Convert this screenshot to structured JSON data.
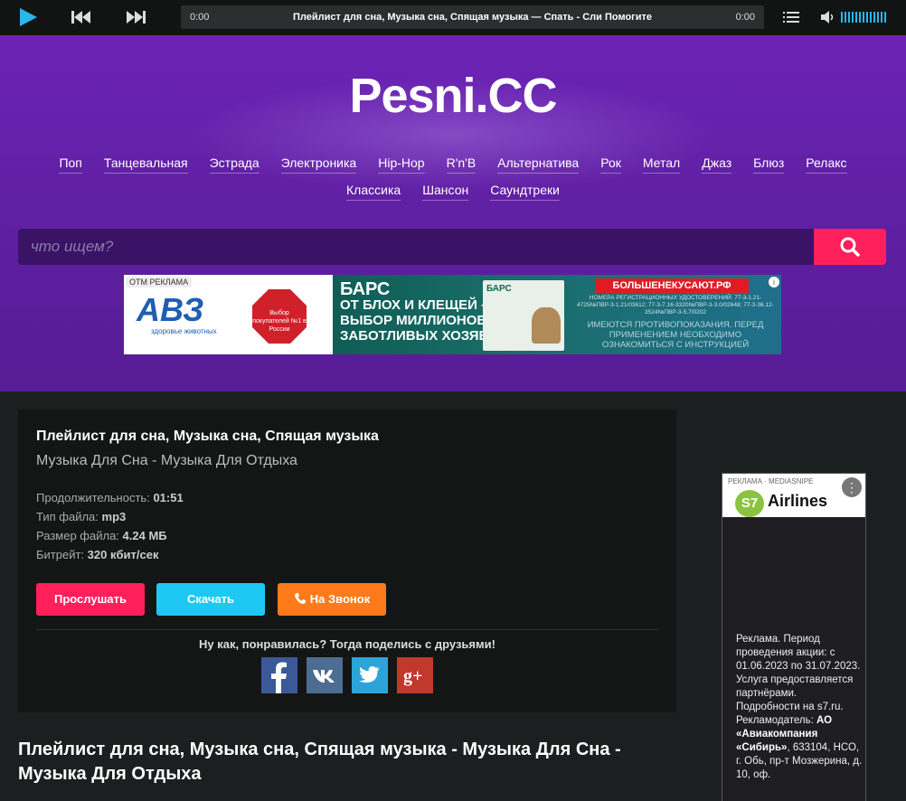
{
  "player": {
    "time_current": "0:00",
    "time_total": "0:00",
    "track_title": "Плейлист для сна, Музыка сна, Спящая музыка — Спать - Сли Помогите"
  },
  "header": {
    "logo": "Pesni.CC",
    "nav_row1": [
      "Поп",
      "Танцевальная",
      "Эстрада",
      "Электроника",
      "Hip-Hop",
      "R'n'B",
      "Альтернатива",
      "Рок",
      "Метал",
      "Джаз",
      "Блюз",
      "Релакс"
    ],
    "nav_row2": [
      "Классика",
      "Шансон",
      "Саундтреки"
    ],
    "search_placeholder": "что ищем?"
  },
  "banner_ad": {
    "label": "ОТМ РЕКЛАМА",
    "brand": "АВЗ",
    "brand_sub": "здоровье животных",
    "badge": "Выбор покупателей №1 в России",
    "headline_big": "БАРС",
    "headline": [
      "ОТ БЛОХ И КЛЕЩЕЙ –",
      "ВЫБОР МИЛЛИОНОВ",
      "ЗАБОТЛИВЫХ ХОЗЯЕВ"
    ],
    "pack_label": "БАРС",
    "site": "БОЛЬШЕНЕКУСАЮТ.РФ",
    "regs": "НОМЕРА РЕГИСТРАЦИОННЫХ УДОСТОВЕРЕНИЙ: 77-3-1.21-4725№ПВР-3-1.21/03612; 77-3-7.16-3320№ПВР-3-3.0/02648; 77-3-36.12-3524№ПВР-3-5.7/0202",
    "warning": "ИМЕЮТСЯ ПРОТИВОПОКАЗАНИЯ. ПЕРЕД ПРИМЕНЕНИЕМ НЕОБХОДИМО ОЗНАКОМИТЬСЯ С ИНСТРУКЦИЕЙ"
  },
  "song": {
    "title": "Плейлист для сна, Музыка сна, Спящая музыка",
    "artist": "Музыка Для Сна - Музыка Для Отдыха",
    "duration_label": "Продолжительность:",
    "duration": "01:51",
    "type_label": "Тип файла:",
    "type": "mp3",
    "size_label": "Размер файла:",
    "size": "4.24 МБ",
    "bitrate_label": "Битрейт:",
    "bitrate": "320 кбит/сек",
    "btn_listen": "Прослушать",
    "btn_download": "Скачать",
    "btn_ringtone": "На Звонок",
    "share_text": "Ну как, понравилась? Тогда поделись с друзьями!",
    "full_heading": "Плейлист для сна, Музыка сна, Спящая музыка - Музыка Для Сна - Музыка Для Отдыха"
  },
  "side_ad": {
    "label": "РЕКЛАМА · MEDIASNIPE",
    "logo_mark": "S7",
    "logo_text": "Airlines",
    "text": "Реклама. Период проведения акции: с 01.06.2023 по 31.07.2023. Услуга предоставляется партнёрами. Подробности на s7.ru. Рекламодатель:",
    "company": "АО «Авиакомпания «Сибирь»",
    "address": ", 633104, НСО, г. Обь, пр-т Мозжерина, д. 10, оф."
  },
  "colors": {
    "header_purple": "#6c23b5",
    "accent_pink": "#ff1f5a",
    "download_blue": "#1ec8f5",
    "ringtone_orange": "#ff7a1a",
    "player_icon": "#29b6e8"
  },
  "icons": [
    "play-icon",
    "previous-icon",
    "next-icon",
    "playlist-icon",
    "volume-icon",
    "search-icon",
    "phone-icon",
    "facebook-icon",
    "vk-icon",
    "twitter-icon",
    "google-plus-icon"
  ]
}
